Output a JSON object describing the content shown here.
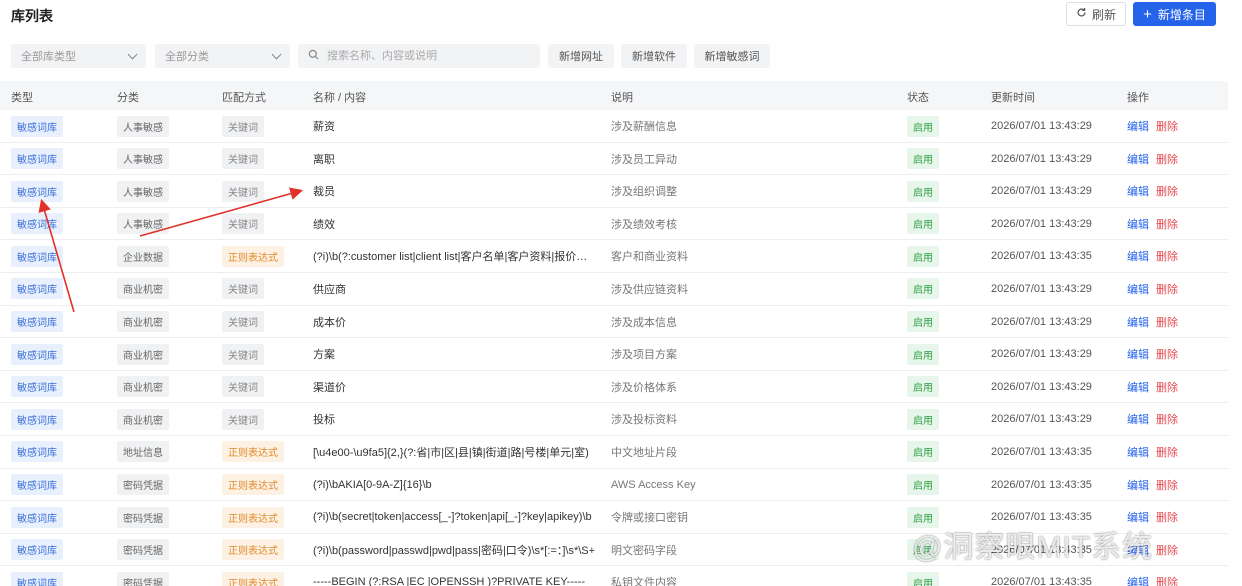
{
  "header": {
    "title": "库列表",
    "refresh_label": "刷新",
    "add_label": "新增条目"
  },
  "filters": {
    "lib_type": "全部库类型",
    "category": "全部分类",
    "search_placeholder": "搜索名称、内容或说明",
    "add_url": "新增网址",
    "add_software": "新增软件",
    "add_sensitive": "新增敏感词"
  },
  "table": {
    "columns": [
      "类型",
      "分类",
      "匹配方式",
      "名称 / 内容",
      "说明",
      "状态",
      "更新时间",
      "操作"
    ],
    "edit_label": "编辑",
    "delete_label": "删除",
    "rows": [
      {
        "type": "敏感词库",
        "category": "人事敏感",
        "match": "关键词",
        "match_kind": "keyword",
        "name": "薪资",
        "desc": "涉及薪酬信息",
        "status": "启用",
        "time": "2026/07/01 13:43:29"
      },
      {
        "type": "敏感词库",
        "category": "人事敏感",
        "match": "关键词",
        "match_kind": "keyword",
        "name": "离职",
        "desc": "涉及员工异动",
        "status": "启用",
        "time": "2026/07/01 13:43:29"
      },
      {
        "type": "敏感词库",
        "category": "人事敏感",
        "match": "关键词",
        "match_kind": "keyword",
        "name": "裁员",
        "desc": "涉及组织调整",
        "status": "启用",
        "time": "2026/07/01 13:43:29"
      },
      {
        "type": "敏感词库",
        "category": "人事敏感",
        "match": "关键词",
        "match_kind": "keyword",
        "name": "绩效",
        "desc": "涉及绩效考核",
        "status": "启用",
        "time": "2026/07/01 13:43:29"
      },
      {
        "type": "敏感词库",
        "category": "企业数据",
        "match": "正则表达式",
        "match_kind": "regex",
        "name": "(?i)\\b(?:customer list|client list|客户名单|客户资料|报价单)\\b",
        "desc": "客户和商业资料",
        "status": "启用",
        "time": "2026/07/01 13:43:35"
      },
      {
        "type": "敏感词库",
        "category": "商业机密",
        "match": "关键词",
        "match_kind": "keyword",
        "name": "供应商",
        "desc": "涉及供应链资料",
        "status": "启用",
        "time": "2026/07/01 13:43:29"
      },
      {
        "type": "敏感词库",
        "category": "商业机密",
        "match": "关键词",
        "match_kind": "keyword",
        "name": "成本价",
        "desc": "涉及成本信息",
        "status": "启用",
        "time": "2026/07/01 13:43:29"
      },
      {
        "type": "敏感词库",
        "category": "商业机密",
        "match": "关键词",
        "match_kind": "keyword",
        "name": "方案",
        "desc": "涉及项目方案",
        "status": "启用",
        "time": "2026/07/01 13:43:29"
      },
      {
        "type": "敏感词库",
        "category": "商业机密",
        "match": "关键词",
        "match_kind": "keyword",
        "name": "渠道价",
        "desc": "涉及价格体系",
        "status": "启用",
        "time": "2026/07/01 13:43:29"
      },
      {
        "type": "敏感词库",
        "category": "商业机密",
        "match": "关键词",
        "match_kind": "keyword",
        "name": "投标",
        "desc": "涉及投标资料",
        "status": "启用",
        "time": "2026/07/01 13:43:29"
      },
      {
        "type": "敏感词库",
        "category": "地址信息",
        "match": "正则表达式",
        "match_kind": "regex",
        "name": "[\\u4e00-\\u9fa5]{2,}(?:省|市|区|县|镇|街道|路|号楼|单元|室)",
        "desc": "中文地址片段",
        "status": "启用",
        "time": "2026/07/01 13:43:35"
      },
      {
        "type": "敏感词库",
        "category": "密码凭据",
        "match": "正则表达式",
        "match_kind": "regex",
        "name": "(?i)\\bAKIA[0-9A-Z]{16}\\b",
        "desc": "AWS Access Key",
        "status": "启用",
        "time": "2026/07/01 13:43:35"
      },
      {
        "type": "敏感词库",
        "category": "密码凭据",
        "match": "正则表达式",
        "match_kind": "regex",
        "name": "(?i)\\b(secret|token|access[_-]?token|api[_-]?key|apikey)\\b",
        "desc": "令牌或接口密钥",
        "status": "启用",
        "time": "2026/07/01 13:43:35"
      },
      {
        "type": "敏感词库",
        "category": "密码凭据",
        "match": "正则表达式",
        "match_kind": "regex",
        "name": "(?i)\\b(password|passwd|pwd|pass|密码|口令)\\s*[:=：]\\s*\\S+",
        "desc": "明文密码字段",
        "status": "启用",
        "time": "2026/07/01 13:43:35"
      },
      {
        "type": "敏感词库",
        "category": "密码凭据",
        "match": "正则表达式",
        "match_kind": "regex",
        "name": "-----BEGIN (?:RSA |EC |OPENSSH )?PRIVATE KEY-----",
        "desc": "私钥文件内容",
        "status": "启用",
        "time": "2026/07/01 13:43:35"
      }
    ]
  },
  "watermark": "@洞察眼MIT系统",
  "colors": {
    "primary": "#2563eb",
    "danger": "#e5484d",
    "success": "#2f9e44",
    "warning": "#e08a2a",
    "annotation": "#e0312a"
  }
}
